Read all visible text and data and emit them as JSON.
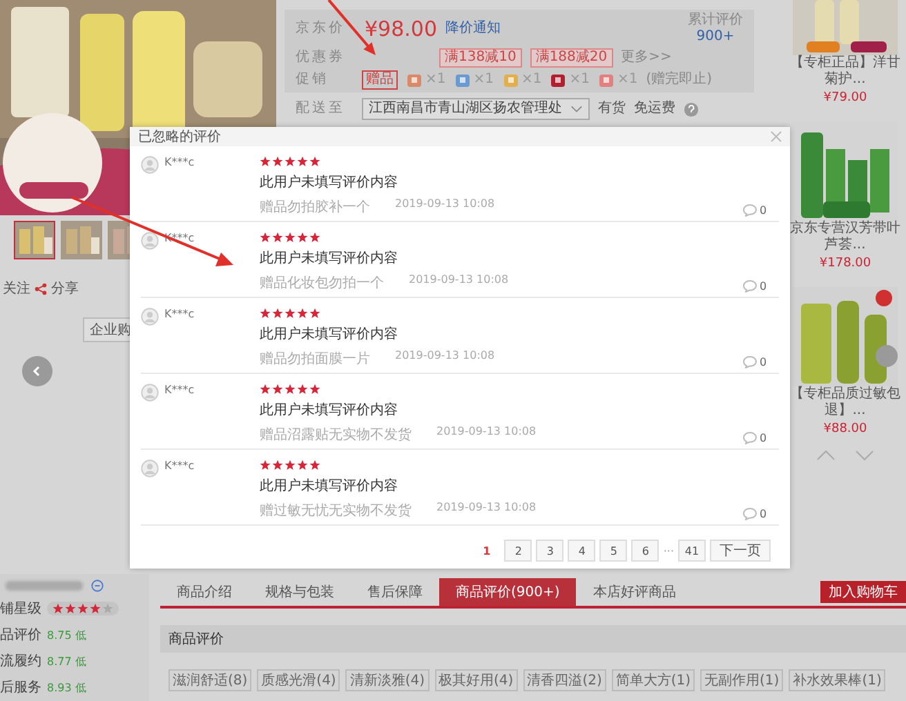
{
  "product": {
    "price_label": "京东价",
    "price": "¥98.00",
    "price_alert": "降价通知",
    "review_label": "累计评价",
    "review_count": "900+",
    "coupon_label": "优惠券",
    "coupons": [
      "满138减10",
      "满188减20"
    ],
    "more": "更多>>",
    "promo_label": "促销",
    "gift_tag": "赠品",
    "gifts": [
      {
        "count": "×1",
        "color": "#d98a6a"
      },
      {
        "count": "×1",
        "color": "#6a9ad0"
      },
      {
        "count": "×1",
        "color": "#e0b050"
      },
      {
        "count": "×1",
        "color": "#b02030"
      },
      {
        "count": "×1",
        "color": "#e08080"
      }
    ],
    "gift_note": "(赠完即止)",
    "delivery_label": "配送至",
    "address": "江西南昌市青山湖区扬农管理处",
    "stock": "有货",
    "shipping": "免运费"
  },
  "gallery": {
    "follow": "关注",
    "share": "分享",
    "enterprise": "企业购"
  },
  "recommendations": [
    {
      "title": "【专柜正品】洋甘菊护...",
      "price": "¥79.00"
    },
    {
      "title": "京东专营汉芳带叶芦荟...",
      "price": "¥178.00"
    },
    {
      "title": "【专柜品质过敏包退】...",
      "price": "¥88.00"
    }
  ],
  "modal": {
    "title": "已忽略的评价",
    "reviews": [
      {
        "user": "K***c",
        "stars": 5,
        "text": "此用户未填写评价内容",
        "tag": "赠品勿拍胶补一个",
        "date": "2019-09-13 10:08",
        "replies": "0"
      },
      {
        "user": "K***c",
        "stars": 5,
        "text": "此用户未填写评价内容",
        "tag": "赠品化妆包勿拍一个",
        "date": "2019-09-13 10:08",
        "replies": "0"
      },
      {
        "user": "K***c",
        "stars": 5,
        "text": "此用户未填写评价内容",
        "tag": "赠品勿拍面膜一片",
        "date": "2019-09-13 10:08",
        "replies": "0"
      },
      {
        "user": "K***c",
        "stars": 5,
        "text": "此用户未填写评价内容",
        "tag": "赠品沼露贴无实物不发货",
        "date": "2019-09-13 10:08",
        "replies": "0"
      },
      {
        "user": "K***c",
        "stars": 5,
        "text": "此用户未填写评价内容",
        "tag": "赠过敏无忧无实物不发货",
        "date": "2019-09-13 10:08",
        "replies": "0"
      }
    ],
    "pages": [
      {
        "kind": "page",
        "label": "1",
        "selected": true
      },
      {
        "kind": "page",
        "label": "2",
        "selected": false
      },
      {
        "kind": "page",
        "label": "3",
        "selected": false
      },
      {
        "kind": "page",
        "label": "4",
        "selected": false
      },
      {
        "kind": "page",
        "label": "5",
        "selected": false
      },
      {
        "kind": "page",
        "label": "6",
        "selected": false
      },
      {
        "kind": "gap",
        "label": "···"
      },
      {
        "kind": "page",
        "label": "41",
        "selected": false
      }
    ],
    "next": "下一页"
  },
  "shop": {
    "rating_label": "铺星级",
    "stars": 4,
    "scores": [
      {
        "label": "品评价",
        "value": "8.75",
        "grade": "低"
      },
      {
        "label": "流履约",
        "value": "8.77",
        "grade": "低"
      },
      {
        "label": "后服务",
        "value": "8.93",
        "grade": "低"
      }
    ]
  },
  "tabs": [
    {
      "label": "商品介绍",
      "selected": false
    },
    {
      "label": "规格与包装",
      "selected": false
    },
    {
      "label": "售后保障",
      "selected": false
    },
    {
      "label": "商品评价(900+)",
      "selected": true
    },
    {
      "label": "本店好评商品",
      "selected": false
    }
  ],
  "cart_button": "加入购物车",
  "section_title": "商品评价",
  "tags": [
    "滋润舒适(8)",
    "质感光滑(4)",
    "清新淡雅(4)",
    "极其好用(4)",
    "清香四溢(2)",
    "简单大方(1)",
    "无副作用(1)",
    "补水效果棒(1)"
  ]
}
